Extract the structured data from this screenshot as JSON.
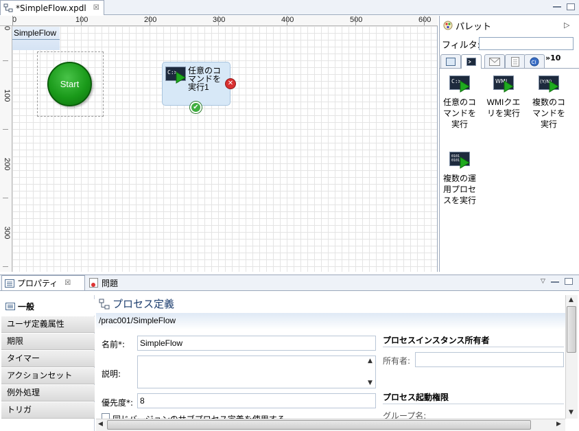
{
  "editor": {
    "tab_title": "*SimpleFlow.xpdl",
    "tab_close": "☒"
  },
  "ruler": {
    "top_labels": [
      "0",
      "100",
      "200",
      "300",
      "400",
      "500",
      "600"
    ],
    "left_labels": [
      "0",
      "100",
      "200",
      "300"
    ]
  },
  "diagram": {
    "pool_name": "SimpleFlow",
    "start_label": "Start",
    "task_label": "任意のコマンドを実行1",
    "task_icon_text": "C:>_"
  },
  "palette": {
    "title": "パレット",
    "filter_label": "フィルタ:",
    "filter_value": "",
    "more_count": "»10",
    "items": [
      {
        "label": "任意のコマンドを実行",
        "icon_text": "C:>_"
      },
      {
        "label": "WMIクエリを実行",
        "icon_text": "WMI"
      },
      {
        "label": "複数のコマンドを実行",
        "icon_text": "(Y/N)"
      },
      {
        "label": "複数の運用プロセスを実行",
        "icon_text": "0101"
      }
    ]
  },
  "views": {
    "properties_tab": "プロパティ",
    "properties_close": "☒",
    "problems_tab": "問題"
  },
  "properties": {
    "tabs": [
      "一般",
      "ユーザ定義属性",
      "期限",
      "タイマー",
      "アクションセット",
      "例外処理",
      "トリガ"
    ],
    "title": "プロセス定義",
    "path": "/prac001/SimpleFlow",
    "name_label": "名前*:",
    "name_value": "SimpleFlow",
    "desc_label": "説明:",
    "desc_value": "",
    "priority_label": "優先度*:",
    "priority_value": "8",
    "checkbox_label": "同じバージョンのサブプロセス定義を使用する",
    "owner_section": "プロセスインスタンス所有者",
    "owner_label": "所有者:",
    "owner_value": "",
    "launch_section": "プロセス起動権限",
    "group_label": "グループ名:"
  },
  "colors": {
    "start_green": "#1a9a1a",
    "task_fill": "#d7e8f7",
    "title_blue": "#1c3d6e"
  }
}
